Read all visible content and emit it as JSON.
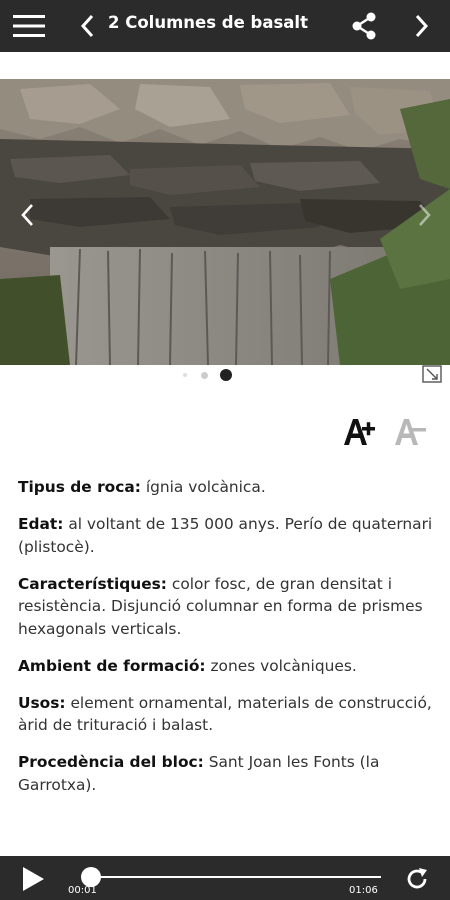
{
  "header": {
    "title": "2 Columnes de basalt",
    "icons": [
      "menu-icon",
      "back-arrow-icon",
      "share-icon",
      "forward-arrow-icon"
    ]
  },
  "gallery": {
    "image_subject": "basalt columns rock wall",
    "slide_count": 3,
    "current_slide": 3
  },
  "sections": [
    {
      "label": "Tipus de roca:",
      "text": " ígnia volcànica."
    },
    {
      "label": "Edat:",
      "text": " al voltant de 135 000 anys. Perío de quaternari (plistocè)."
    },
    {
      "label": "Característiques:",
      "text": " color fosc, de gran densitat i resistència. Disjunció columnar en forma de prismes hexagonals verticals."
    },
    {
      "label": "Ambient de formació:",
      "text": " zones volcàniques."
    },
    {
      "label": "Usos:",
      "text": " element ornamental, materials de construcció, àrid de trituració i balast."
    },
    {
      "label": "Procedència del bloc:",
      "text": " Sant Joan les Fonts (la Garrotxa)."
    }
  ],
  "player": {
    "elapsed": "00:01",
    "duration": "01:06",
    "progress": 0.02
  },
  "colors": {
    "bar": "#2b2b2b",
    "text": "#333333"
  }
}
